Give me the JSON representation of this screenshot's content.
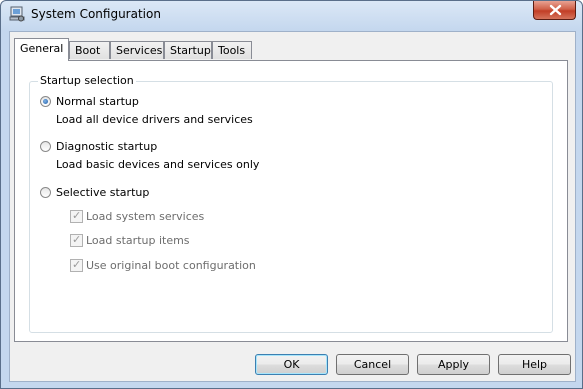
{
  "window": {
    "title": "System Configuration",
    "close_icon": "close-icon",
    "app_icon": "msconfig-icon"
  },
  "tabs": [
    {
      "label": "General",
      "active": true
    },
    {
      "label": "Boot"
    },
    {
      "label": "Services"
    },
    {
      "label": "Startup"
    },
    {
      "label": "Tools"
    }
  ],
  "startup_selection": {
    "title": "Startup selection",
    "options": [
      {
        "label": "Normal startup",
        "description": "Load all device drivers and services",
        "selected": true
      },
      {
        "label": "Diagnostic startup",
        "description": "Load basic devices and services only",
        "selected": false
      },
      {
        "label": "Selective startup",
        "description": "",
        "selected": false
      }
    ],
    "selective_items": [
      {
        "label": "Load system services",
        "checked": true,
        "enabled": false
      },
      {
        "label": "Load startup items",
        "checked": true,
        "enabled": false
      },
      {
        "label": "Use original boot configuration",
        "checked": true,
        "enabled": false
      }
    ]
  },
  "buttons": {
    "ok": "OK",
    "cancel": "Cancel",
    "apply": "Apply",
    "help": "Help"
  },
  "colors": {
    "title_bar": "#c4d7ee",
    "close_button": "#c23e26",
    "accent": "#1d5aa5"
  }
}
